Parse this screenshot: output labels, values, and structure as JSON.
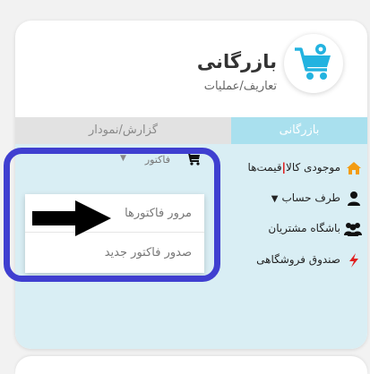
{
  "header": {
    "title": "بازرگانی",
    "subtitle": "تعاریف/عملیات",
    "logo_icon": "shopping-cart-gear-icon",
    "accent_color": "#23b3e0"
  },
  "tabs": [
    {
      "label": "بازرگانی",
      "active": true
    },
    {
      "label": "گزارش/نمودار",
      "active": false
    }
  ],
  "menu": {
    "items": [
      {
        "part1": "موجودی کالا",
        "separator": "|",
        "part2": "قیمت‌ها",
        "icon": "home-icon"
      },
      {
        "label": "طرف حساب",
        "caret": "▼",
        "icon": "user-icon"
      },
      {
        "label": "باشگاه مشتریان",
        "icon": "users-icon"
      },
      {
        "label": "صندوق فروشگاهی",
        "icon": "bolt-icon"
      }
    ]
  },
  "factor_menu": {
    "label": "فاکتور",
    "caret": "▼",
    "icon": "cart-icon",
    "items": [
      {
        "label": "مرور فاکتورها"
      },
      {
        "label": "صدور فاکتور جدید"
      }
    ]
  },
  "annotation_color": "#3f3fd0"
}
